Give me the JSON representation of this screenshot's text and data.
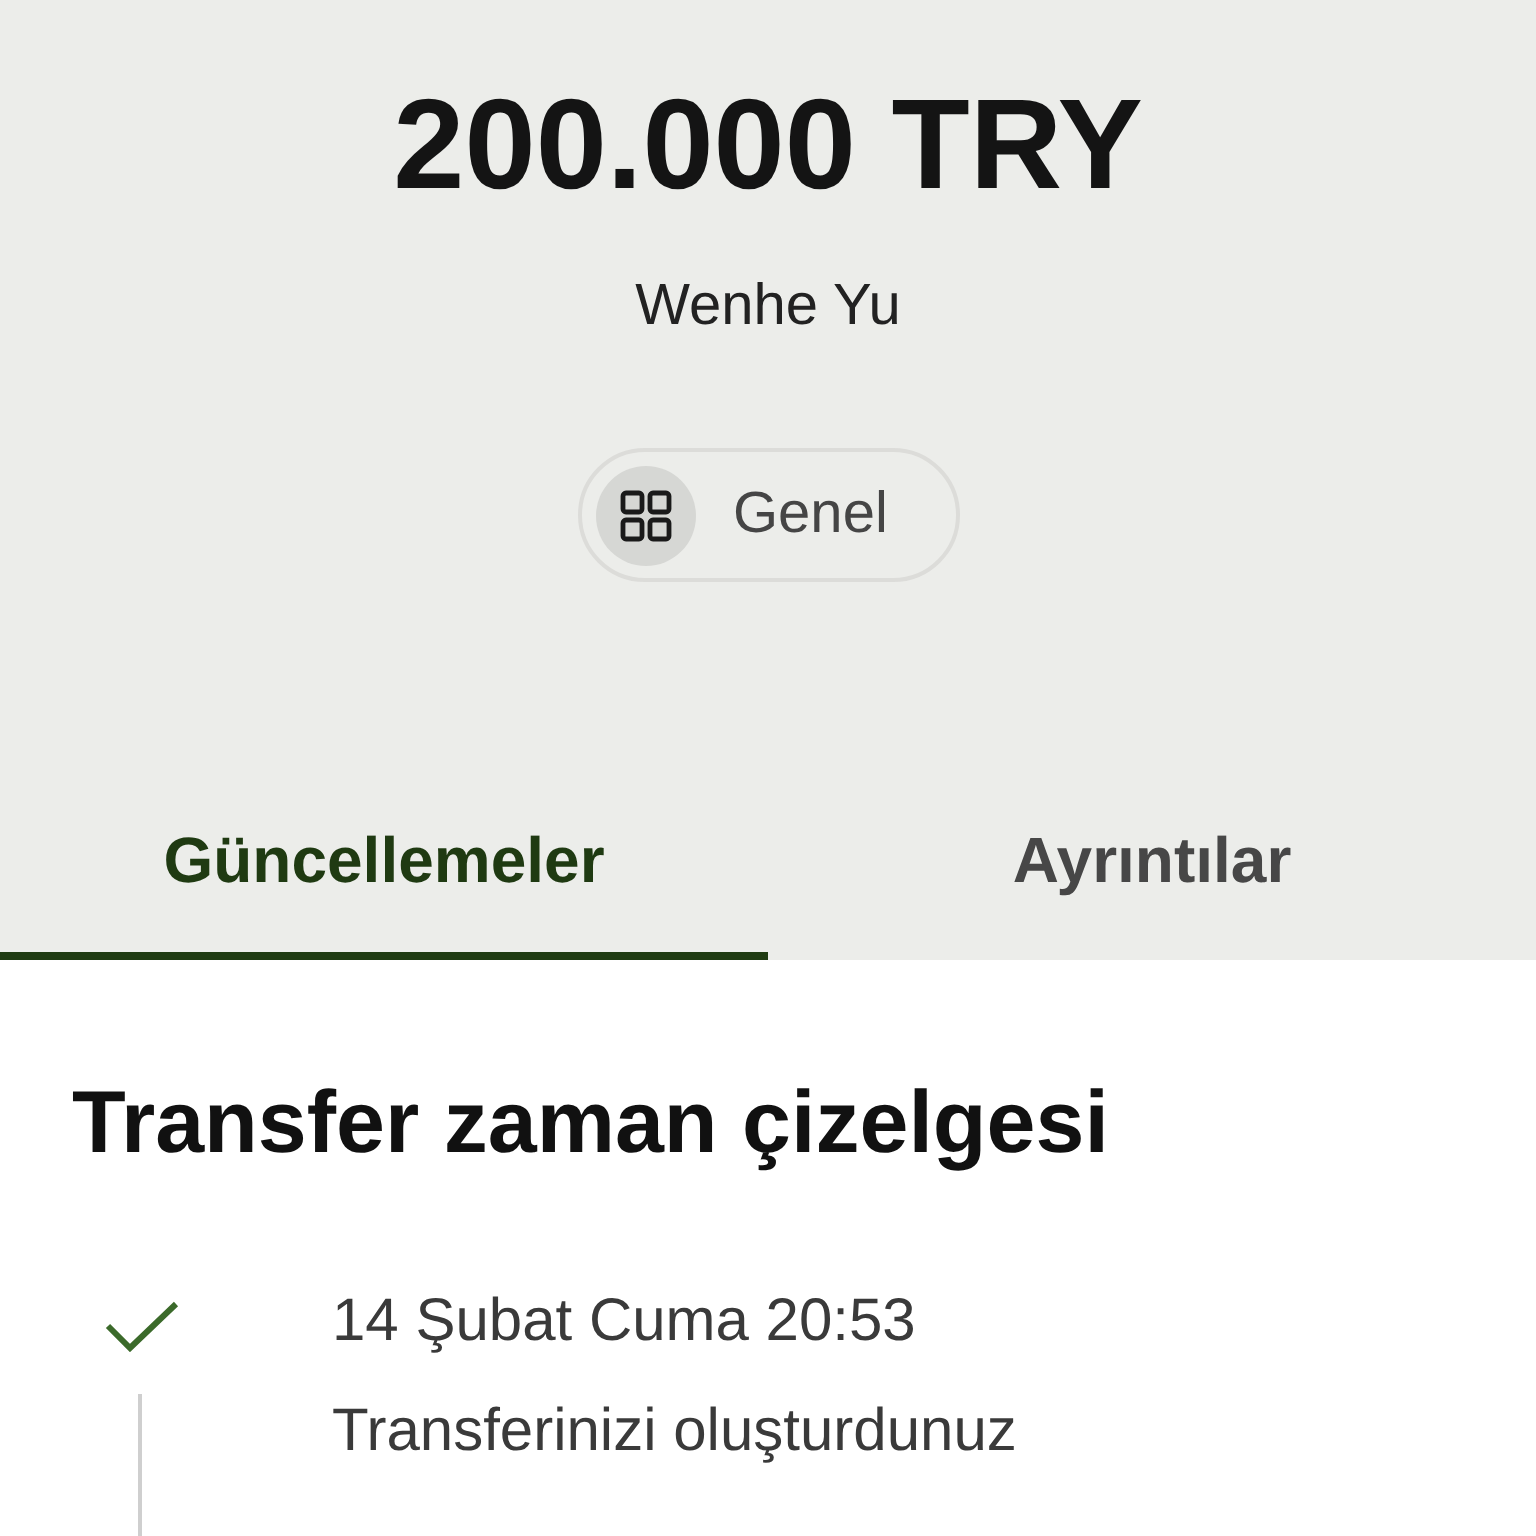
{
  "transfer": {
    "amount": "200.000 TRY",
    "recipient": "Wenhe Yu",
    "category": {
      "label": "Genel"
    }
  },
  "tabs": [
    {
      "label": "Güncellemeler",
      "selected": true
    },
    {
      "label": "Ayrıntılar",
      "selected": false
    }
  ],
  "timeline": {
    "title": "Transfer zaman çizelgesi",
    "events": [
      {
        "date": "14 Şubat Cuma 20:53",
        "description": "Transferinizi oluşturdunuz",
        "completed": true
      }
    ]
  }
}
